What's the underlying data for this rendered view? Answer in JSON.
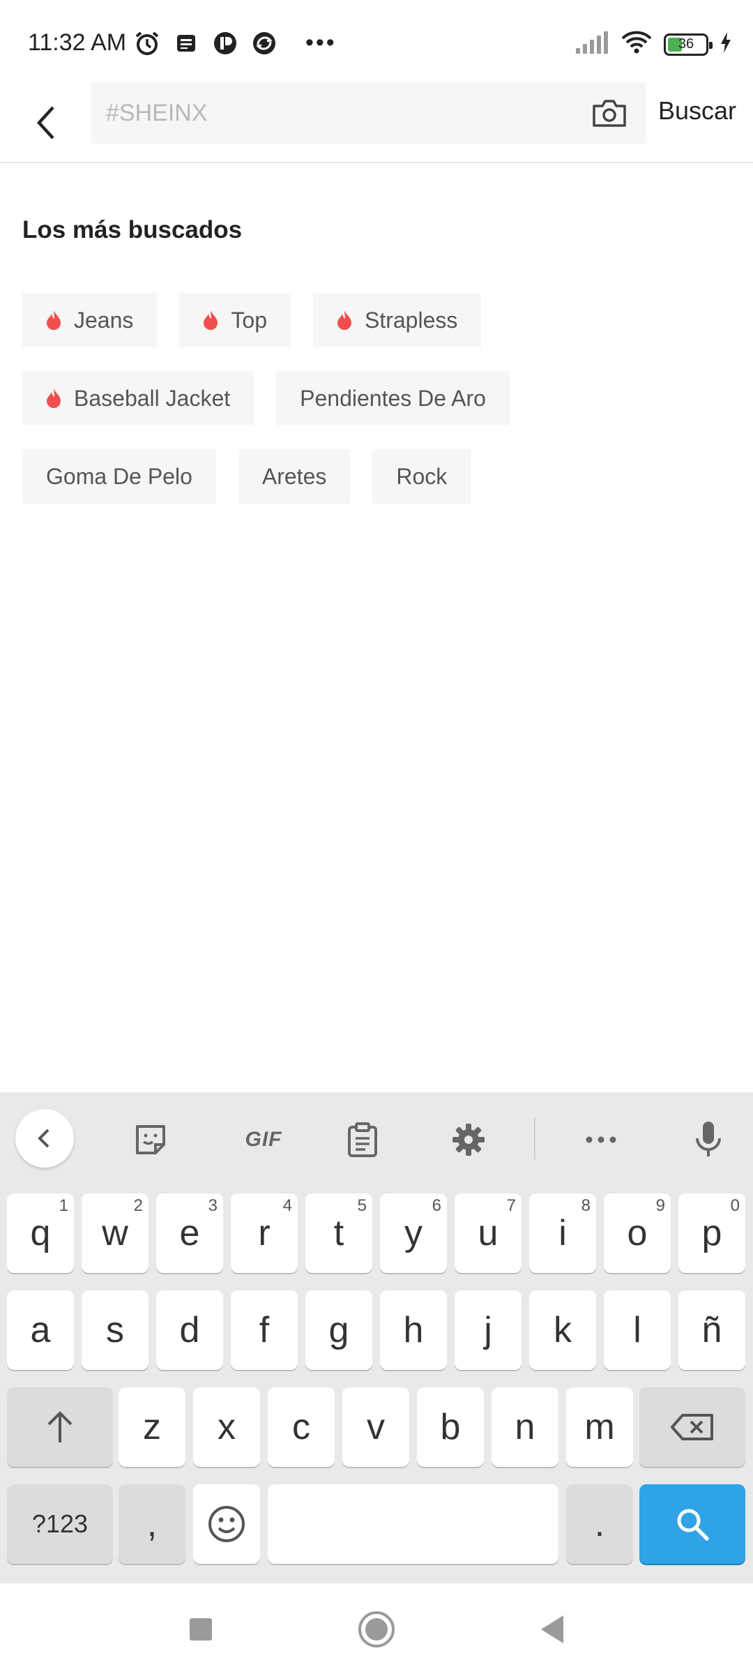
{
  "status_bar": {
    "time": "11:32 AM",
    "battery_level": "36",
    "icons": [
      "alarm-icon",
      "notes-icon",
      "app-icon",
      "app-icon-2",
      "more-dots-icon",
      "signal-icon",
      "wifi-icon",
      "battery-icon",
      "charging-icon"
    ]
  },
  "search": {
    "placeholder": "#SHEINX",
    "value": "",
    "submit_label": "Buscar"
  },
  "hot_searches": {
    "title": "Los más buscados",
    "rows": [
      [
        {
          "label": "Jeans",
          "hot": true
        },
        {
          "label": "Top",
          "hot": true
        },
        {
          "label": "Strapless",
          "hot": true
        }
      ],
      [
        {
          "label": "Baseball Jacket",
          "hot": true
        },
        {
          "label": "Pendientes De Aro",
          "hot": false
        }
      ],
      [
        {
          "label": "Goma De Pelo",
          "hot": false
        },
        {
          "label": "Aretes",
          "hot": false
        },
        {
          "label": "Rock",
          "hot": false
        }
      ]
    ],
    "flame_color": "#f04e4e"
  },
  "keyboard": {
    "toolbar": {
      "gif_label": "GIF"
    },
    "row1": [
      {
        "k": "q",
        "h": "1"
      },
      {
        "k": "w",
        "h": "2"
      },
      {
        "k": "e",
        "h": "3"
      },
      {
        "k": "r",
        "h": "4"
      },
      {
        "k": "t",
        "h": "5"
      },
      {
        "k": "y",
        "h": "6"
      },
      {
        "k": "u",
        "h": "7"
      },
      {
        "k": "i",
        "h": "8"
      },
      {
        "k": "o",
        "h": "9"
      },
      {
        "k": "p",
        "h": "0"
      }
    ],
    "row2": [
      "a",
      "s",
      "d",
      "f",
      "g",
      "h",
      "j",
      "k",
      "l",
      "ñ"
    ],
    "row3": [
      "z",
      "x",
      "c",
      "v",
      "b",
      "n",
      "m"
    ],
    "symbols_label": "?123",
    "comma_label": ",",
    "period_label": ".",
    "search_key_color": "#2fa3e6"
  }
}
